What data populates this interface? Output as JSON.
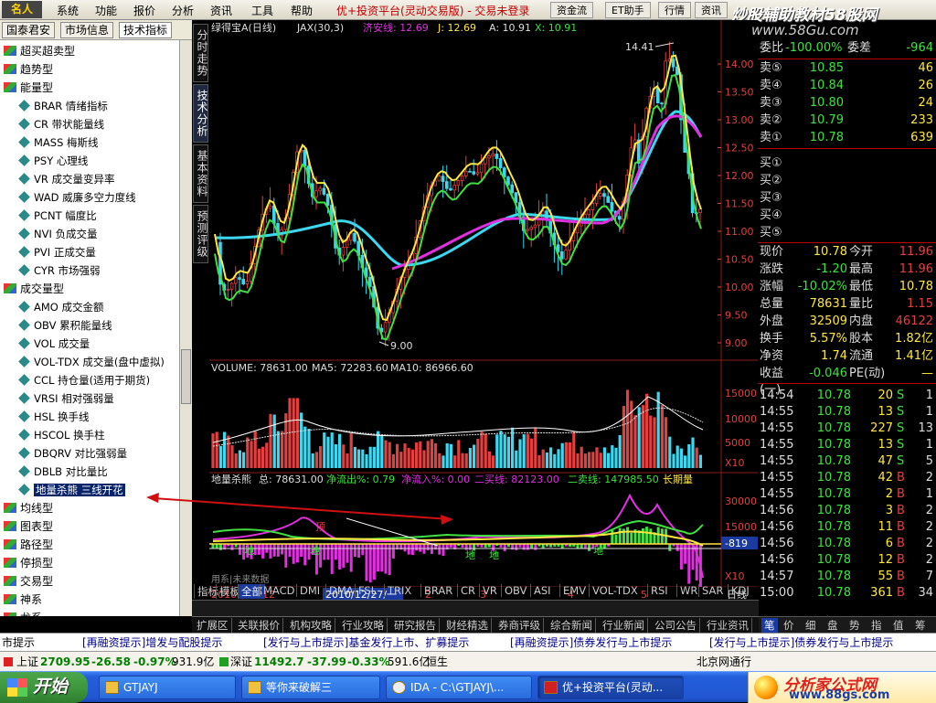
{
  "menubar": {
    "logo": "名人",
    "items": [
      "系统",
      "功能",
      "报价",
      "分析",
      "资讯",
      "工具",
      "帮助"
    ],
    "title": "优+投资平台(灵动交易版) - 交易未登录",
    "buttons": [
      "资金流",
      "ET助手",
      "行情",
      "资讯"
    ],
    "watermark": "炒股辅助教材58股网",
    "watermark_url": "www.58Gu.com"
  },
  "left_tabs": [
    "国泰君安",
    "市场信息",
    "技术指标"
  ],
  "sidebar": {
    "items": [
      {
        "label": "超买超卖型",
        "kind": "cat"
      },
      {
        "label": "趋势型",
        "kind": "cat"
      },
      {
        "label": "能量型",
        "kind": "cat"
      },
      {
        "label": "BRAR 情绪指标",
        "kind": "sub"
      },
      {
        "label": "CR 带状能量线",
        "kind": "sub"
      },
      {
        "label": "MASS 梅斯线",
        "kind": "sub"
      },
      {
        "label": "PSY 心理线",
        "kind": "sub"
      },
      {
        "label": "VR 成交量变异率",
        "kind": "sub"
      },
      {
        "label": "WAD 威廉多空力度线",
        "kind": "sub"
      },
      {
        "label": "PCNT 幅度比",
        "kind": "sub"
      },
      {
        "label": "NVI 负成交量",
        "kind": "sub"
      },
      {
        "label": "PVI 正成交量",
        "kind": "sub"
      },
      {
        "label": "CYR 市场强弱",
        "kind": "sub"
      },
      {
        "label": "成交量型",
        "kind": "cat"
      },
      {
        "label": "AMO 成交金额",
        "kind": "sub"
      },
      {
        "label": "OBV 累积能量线",
        "kind": "sub"
      },
      {
        "label": "VOL 成交量",
        "kind": "sub"
      },
      {
        "label": "VOL-TDX 成交量(盘中虚拟)",
        "kind": "sub"
      },
      {
        "label": "CCL 持仓量(适用于期货)",
        "kind": "sub"
      },
      {
        "label": "VRSI 相对强弱量",
        "kind": "sub"
      },
      {
        "label": "HSL 换手线",
        "kind": "sub"
      },
      {
        "label": "HSCOL 换手柱",
        "kind": "sub"
      },
      {
        "label": "DBQRV 对比强弱量",
        "kind": "sub"
      },
      {
        "label": "DBLB 对比量比",
        "kind": "sub"
      },
      {
        "label": "地量杀熊 三线开花",
        "kind": "sub",
        "selected": true
      },
      {
        "label": "均线型",
        "kind": "cat"
      },
      {
        "label": "图表型",
        "kind": "cat"
      },
      {
        "label": "路径型",
        "kind": "cat"
      },
      {
        "label": "停损型",
        "kind": "cat"
      },
      {
        "label": "交易型",
        "kind": "cat"
      },
      {
        "label": "神系",
        "kind": "cat"
      },
      {
        "label": "龙系",
        "kind": "cat"
      },
      {
        "label": "鬼系",
        "kind": "cat"
      }
    ]
  },
  "vtabs": [
    "分时走势",
    "技术分析",
    "基本资料",
    "预测评级"
  ],
  "chart": {
    "header": {
      "name": "绿得宝A(日线)",
      "ind": "JAX(30,3)",
      "lbl1": "济安线: 12.69",
      "lbl2": "J: 12.69",
      "lbl3": "A: 10.91",
      "lbl4": "X: 10.91"
    },
    "price_axis": [
      "14.00",
      "13.50",
      "13.00",
      "12.50",
      "12.00",
      "11.50",
      "11.00",
      "10.50",
      "10.00",
      "9.50",
      "9.00"
    ],
    "high_label": "14.41",
    "low_label": "9.00",
    "volume_header": {
      "a": "VOLUME: 78631.00",
      "b": "MA5: 72283.60",
      "c": "MA10: 86966.60"
    },
    "volume_axis": [
      "15000",
      "10000",
      "5000",
      "X10"
    ],
    "ind_header": {
      "name": "地量杀熊",
      "a": "总: 78631.00",
      "b": "净流出%: 0.79",
      "c": "净流入%: 0.00",
      "d": "二买线: 82123.00",
      "e": "二卖线: 147985.50",
      "f": "长期量"
    },
    "ind_axis": [
      "30000",
      "15000",
      "X10"
    ],
    "ind_value": "-819",
    "ind_markers": [
      "地",
      "地",
      "地",
      "地",
      "地"
    ],
    "ind_red_marker": "顶",
    "footnote": "用系|未来数据",
    "date_axis": {
      "year": "2010年",
      "sel": "2010/12/27/一",
      "labels": [
        "12",
        "2",
        "3",
        "4",
        "5"
      ],
      "period": "日线"
    },
    "bottom_tabs": [
      "指标",
      "模板",
      "全部",
      "MACD",
      "DMI",
      "DMA",
      "FSL",
      "TRIX",
      "BRAR",
      "CR",
      "VR",
      "OBV",
      "ASI",
      "EMV",
      "VOL-TDX",
      "RSI",
      "WR",
      "SAR",
      "KDJ"
    ]
  },
  "quote": {
    "top_row": {
      "a": "委比",
      "b": "-100.00%",
      "c": "委差",
      "d": "-964"
    },
    "sells": [
      {
        "label": "卖⑤",
        "price": "10.85",
        "vol": "46"
      },
      {
        "label": "卖④",
        "price": "10.84",
        "vol": "26"
      },
      {
        "label": "卖③",
        "price": "10.80",
        "vol": "24"
      },
      {
        "label": "卖②",
        "price": "10.79",
        "vol": "233"
      },
      {
        "label": "卖①",
        "price": "10.78",
        "vol": "639"
      }
    ],
    "buys": [
      "买①",
      "买②",
      "买③",
      "买④",
      "买⑤"
    ],
    "stats": [
      {
        "l1": "现价",
        "v1": "10.78",
        "l2": "今开",
        "v2": "11.96"
      },
      {
        "l1": "涨跌",
        "v1": "-1.20",
        "l2": "最高",
        "v2": "11.96"
      },
      {
        "l1": "涨幅",
        "v1": "-10.02%",
        "l2": "最低",
        "v2": "10.78"
      },
      {
        "l1": "总量",
        "v1": "78631",
        "l2": "量比",
        "v2": "1.15"
      },
      {
        "l1": "外盘",
        "v1": "32509",
        "l2": "内盘",
        "v2": "46122"
      },
      {
        "l1": "换手",
        "v1": "5.57%",
        "l2": "股本",
        "v2": "1.82亿"
      },
      {
        "l1": "净资",
        "v1": "1.74",
        "l2": "流通",
        "v2": "1.41亿"
      },
      {
        "l1": "收益(一)",
        "v1": "-0.046",
        "l2": "PE(动)",
        "v2": "—"
      }
    ],
    "ticks": [
      {
        "time": "14:54",
        "price": "10.78",
        "vol": "20",
        "side": "S",
        "n": "1"
      },
      {
        "time": "14:55",
        "price": "10.78",
        "vol": "13",
        "side": "S",
        "n": "1"
      },
      {
        "time": "14:55",
        "price": "10.78",
        "vol": "227",
        "side": "S",
        "n": "13"
      },
      {
        "time": "14:55",
        "price": "10.78",
        "vol": "13",
        "side": "S",
        "n": "1"
      },
      {
        "time": "14:55",
        "price": "10.78",
        "vol": "47",
        "side": "S",
        "n": "5"
      },
      {
        "time": "14:55",
        "price": "10.78",
        "vol": "42",
        "side": "B",
        "n": "2"
      },
      {
        "time": "14:55",
        "price": "10.78",
        "vol": "2",
        "side": "B",
        "n": "1"
      },
      {
        "time": "14:56",
        "price": "10.78",
        "vol": "3",
        "side": "B",
        "n": "2"
      },
      {
        "time": "14:56",
        "price": "10.78",
        "vol": "11",
        "side": "B",
        "n": "2"
      },
      {
        "time": "14:56",
        "price": "10.78",
        "vol": "6",
        "side": "B",
        "n": "2"
      },
      {
        "time": "14:56",
        "price": "10.78",
        "vol": "12",
        "side": "B",
        "n": "2"
      },
      {
        "time": "14:57",
        "price": "10.78",
        "vol": "55",
        "side": "B",
        "n": "7"
      },
      {
        "time": "15:00",
        "price": "10.78",
        "vol": "361",
        "side": "B",
        "n": "34"
      }
    ],
    "right_tabs": [
      "笔",
      "价",
      "细",
      "盘",
      "势",
      "指",
      "值",
      "筹"
    ]
  },
  "info_tabs": [
    "扩展区",
    "关联报价",
    "机构攻略",
    "行业攻略",
    "研究报告",
    "财经精选",
    "券商评级",
    "综合新闻",
    "行业新闻",
    "公司公告",
    "行业资讯"
  ],
  "news": [
    "市提示",
    "[再融资提示]增发与配股提示",
    "[发行与上市提示]基金发行上市、扩募提示",
    "[再融资提示]债券发行与上市提示",
    "[发行与上市提示]债券发行与上市提示"
  ],
  "indexbar": {
    "sh_label": "上证",
    "sh_val": "2709.95",
    "sh_chg": "-26.58",
    "sh_pct": "-0.97%",
    "sh_amt": "931.9亿",
    "sz_label": "深证",
    "sz_val": "11492.7",
    "sz_chg": "-37.99",
    "sz_pct": "-0.33%",
    "sz_amt": "591.6亿",
    "hs": "恒生",
    "site": "北京网通行"
  },
  "taskbar": {
    "start": "开始",
    "tasks": [
      "GTJAYJ",
      "等你来破解三",
      "IDA - C:\\GTJAYJ\\...",
      "优+投资平台(灵动..."
    ],
    "banner_title": "分析家公式网",
    "banner_url": "www.88gs.com"
  }
}
